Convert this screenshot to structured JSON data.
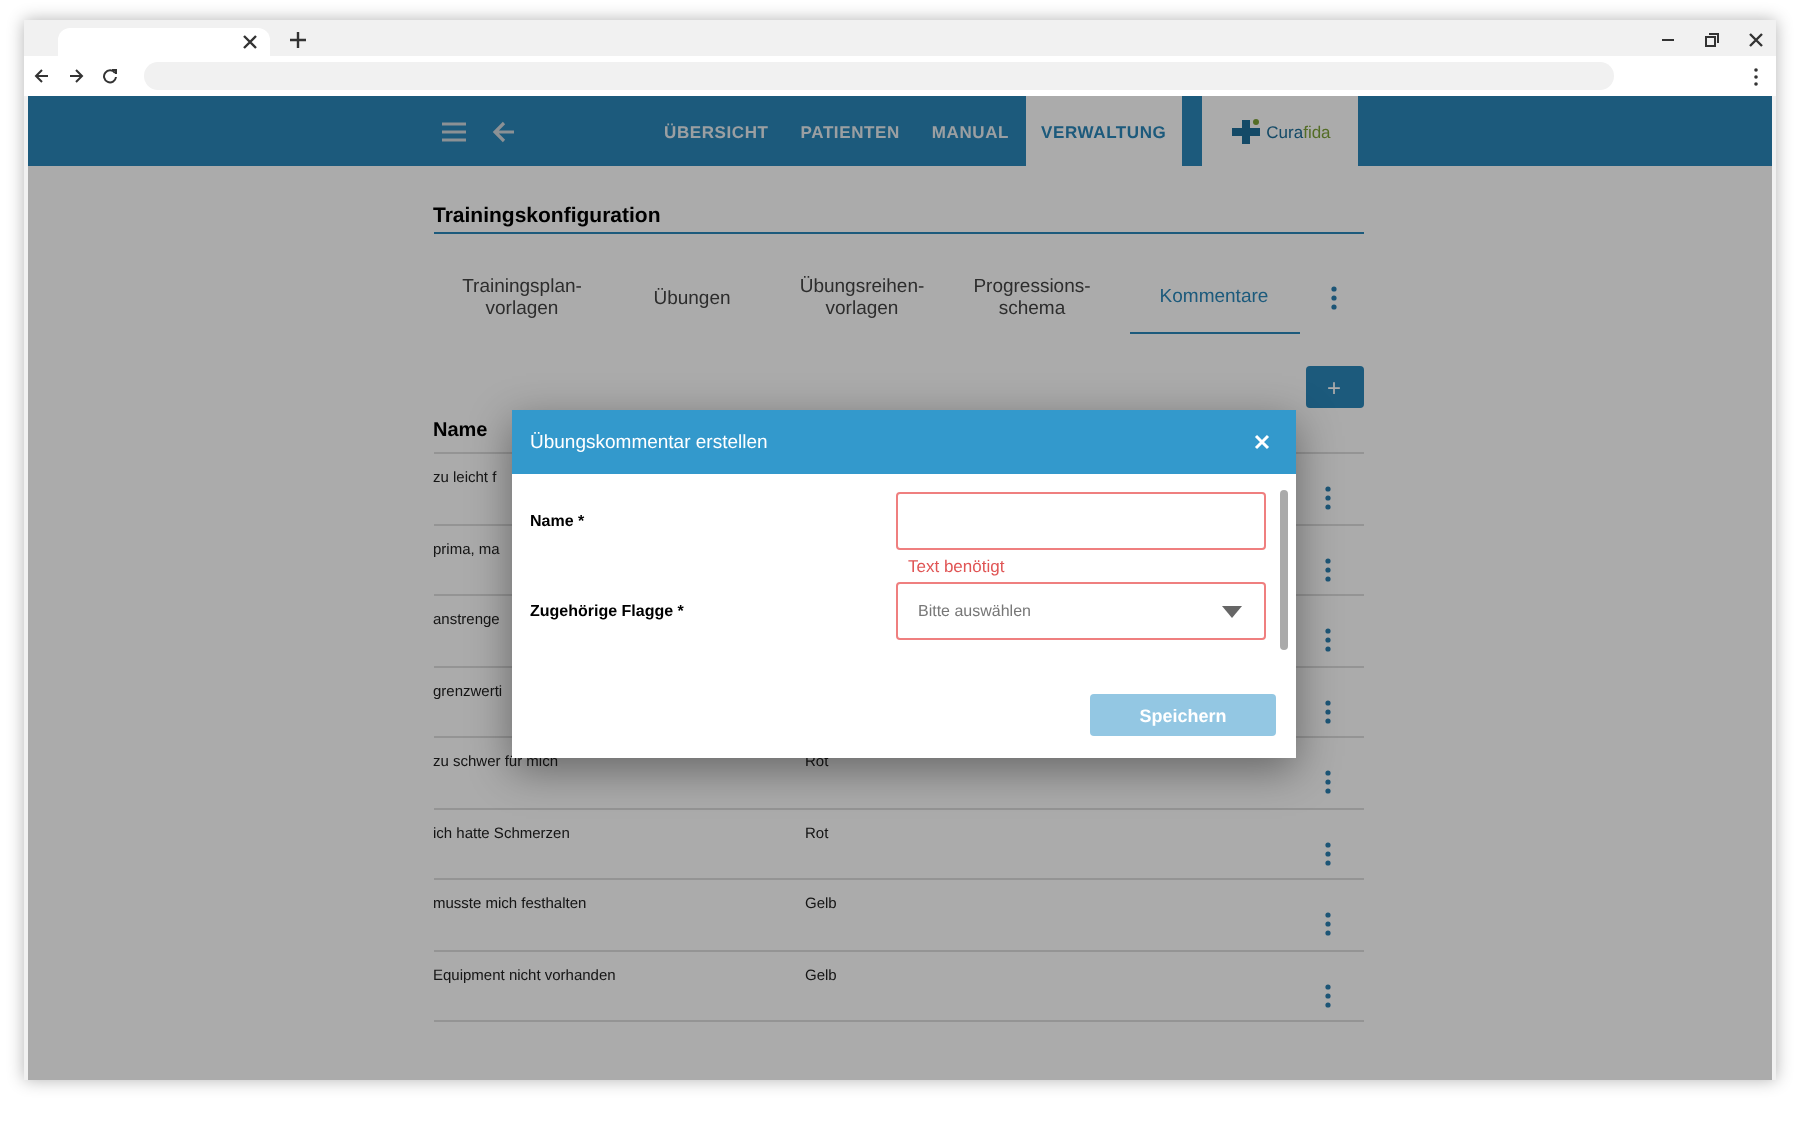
{
  "header": {
    "nav": [
      {
        "label": "ÜBERSICHT",
        "selected": false
      },
      {
        "label": "PATIENTEN",
        "selected": false
      },
      {
        "label": "MANUAL",
        "selected": false
      },
      {
        "label": "VERWALTUNG",
        "selected": true
      }
    ],
    "logo_text": [
      "Cura",
      "fida"
    ]
  },
  "section_title": "Trainingskonfiguration",
  "tabs": [
    {
      "label": "Trainingsplan-\nvorlagen",
      "selected": false
    },
    {
      "label": "Übungen",
      "selected": false
    },
    {
      "label": "Übungsreihen-\nvorlagen",
      "selected": false
    },
    {
      "label": "Progressions-\nschema",
      "selected": false
    },
    {
      "label": "Kommentare",
      "selected": true
    }
  ],
  "add_button": "+",
  "table": {
    "columns": [
      "Name"
    ],
    "rows": [
      {
        "name": "zu leicht f"
      },
      {
        "name": "prima, ma"
      },
      {
        "name": "anstrenge"
      },
      {
        "name": "grenzwerti"
      },
      {
        "name": "zu schwer für mich",
        "flag": "Rot"
      },
      {
        "name": "ich hatte Schmerzen",
        "flag": "Rot"
      },
      {
        "name": "musste mich festhalten",
        "flag": "Gelb"
      },
      {
        "name": "Equipment nicht vorhanden",
        "flag": "Gelb"
      }
    ]
  },
  "dialog": {
    "title": "Übungskommentar erstellen",
    "fields": [
      {
        "kind": "text",
        "label": "Name *",
        "error": "Text benötigt",
        "invalid": true
      },
      {
        "kind": "select",
        "label": "Zugehörige Flagge *",
        "placeholder": "Bitte auswählen",
        "invalid": true
      }
    ],
    "save_button": {
      "label": "Speichern",
      "disabled": true
    }
  }
}
